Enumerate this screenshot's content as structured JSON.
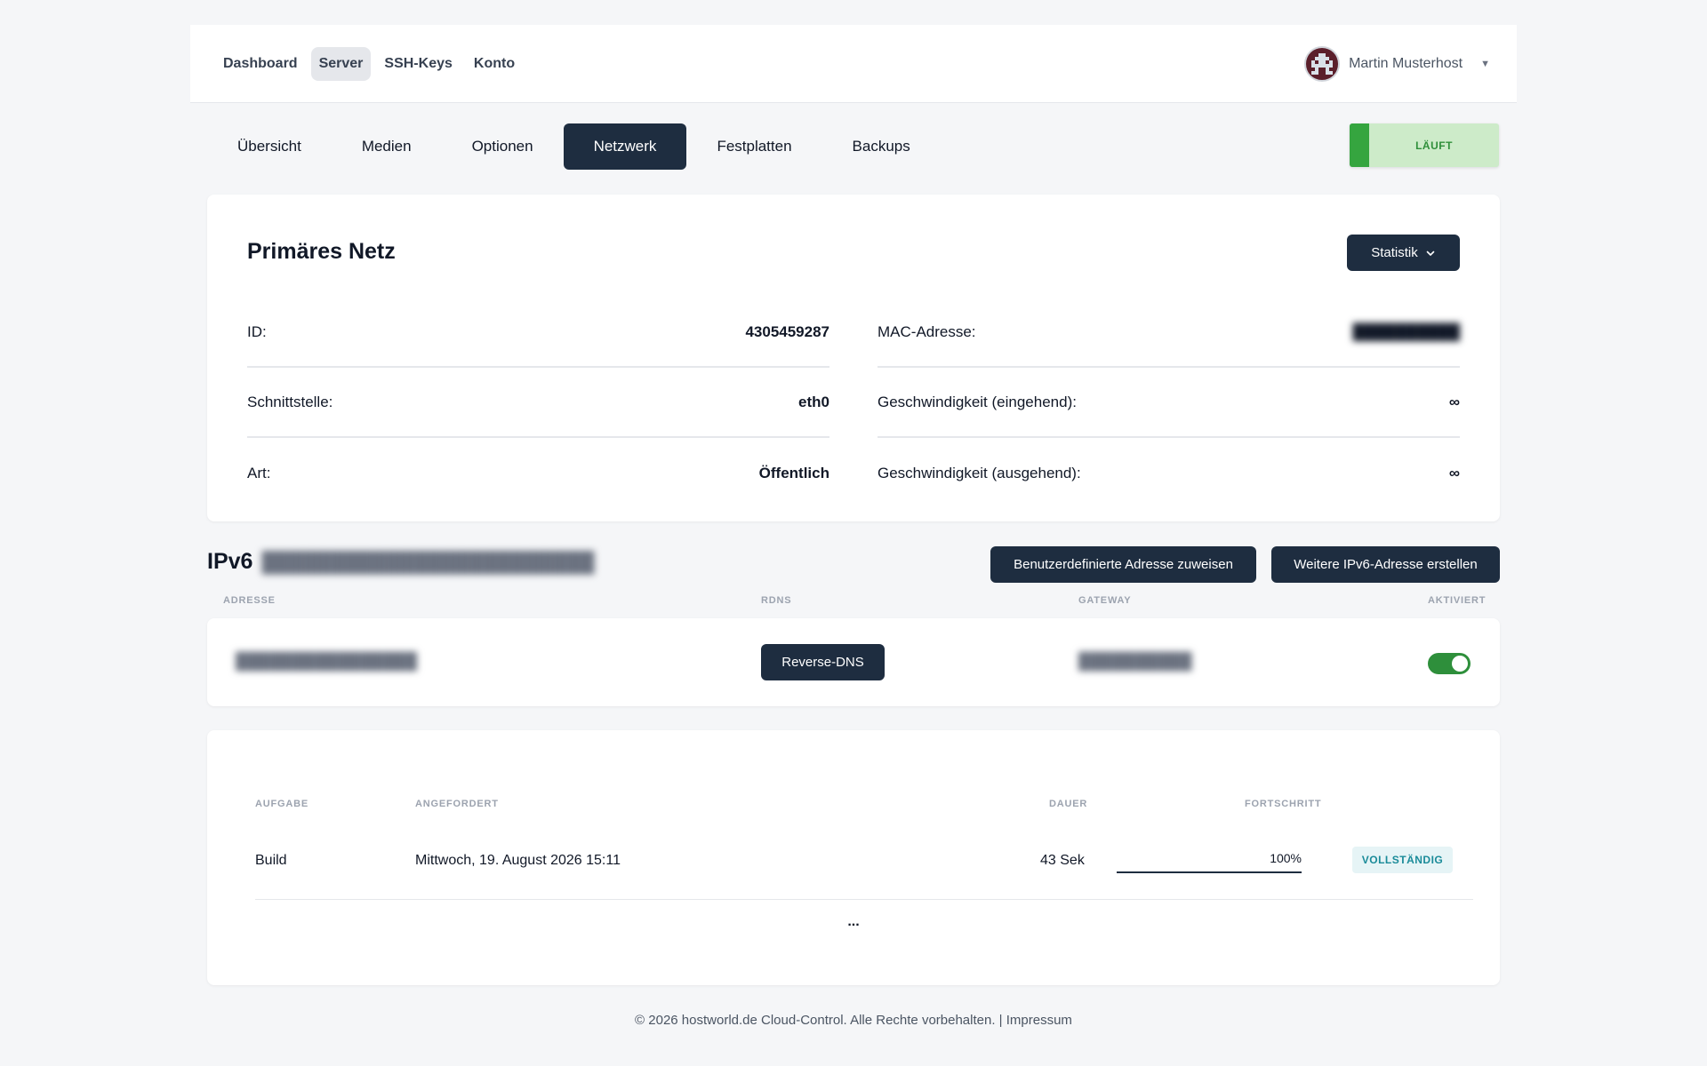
{
  "nav": {
    "links": [
      "Dashboard",
      "Server",
      "SSH-Keys",
      "Konto"
    ],
    "active": "Server",
    "user_name": "Martin Musterhost"
  },
  "subtabs": [
    "Übersicht",
    "Medien",
    "Optionen",
    "Netzwerk",
    "Festplatten",
    "Backups"
  ],
  "active_subtab": "Netzwerk",
  "status": {
    "label": "LÄUFT",
    "color": "#35a53f"
  },
  "primary_network": {
    "title": "Primäres Netz",
    "stat_button": "Statistik",
    "left": [
      {
        "key": "ID:",
        "value": "4305459287"
      },
      {
        "key": "Schnittstelle:",
        "value": "eth0"
      },
      {
        "key": "Art:",
        "value": "Öffentlich"
      }
    ],
    "right": [
      {
        "key": "MAC-Adresse:",
        "value": ""
      },
      {
        "key": "Geschwindigkeit (eingehend):",
        "value": "∞"
      },
      {
        "key": "Geschwindigkeit (ausgehend):",
        "value": "∞"
      }
    ]
  },
  "ipv6": {
    "title": "IPv6",
    "custom_button": "Benutzerdefinierte Adresse zuweisen",
    "new_button": "Weitere IPv6-Adresse erstellen",
    "headers": [
      "ADRESSE",
      "RDNS",
      "GATEWAY",
      "AKTIVIERT"
    ],
    "rdns_button": "Reverse-DNS",
    "enabled": true
  },
  "tasks": {
    "headers": [
      "AUFGABE",
      "ANGEFORDERT",
      "DAUER",
      "FORTSCHRITT"
    ],
    "rows": [
      {
        "task": "Build",
        "requested": "Mittwoch, 19. August 2026 15:11",
        "duration": "43 Sek",
        "progress": 100,
        "progress_label": "100%",
        "status": "VOLLSTÄNDIG"
      }
    ],
    "more": "..."
  },
  "footer": {
    "text": "© 2026 hostworld.de Cloud-Control. Alle Rechte vorbehalten. |",
    "link": "Impressum"
  }
}
